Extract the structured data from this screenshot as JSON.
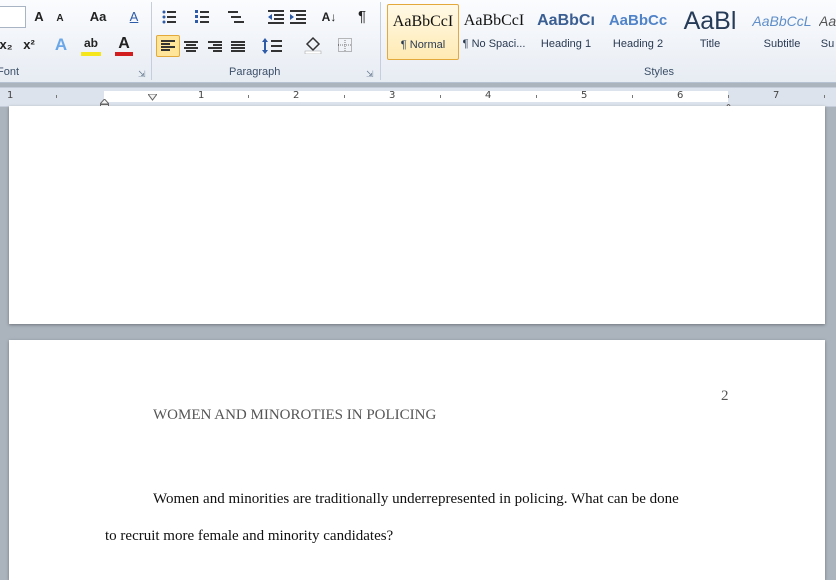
{
  "ribbon": {
    "font_group": {
      "label": "Font",
      "grow": "A",
      "shrink": "A",
      "change_case": "Aa",
      "clear_format": "A",
      "subscript": "x₂",
      "superscript": "x²",
      "text_effects": "A",
      "highlight": "ab",
      "font_color": "A",
      "font_color_value": "#d11d1d",
      "highlight_color_value": "#f5e61c"
    },
    "paragraph_group": {
      "label": "Paragraph",
      "show_marks": "¶",
      "sort": "A↓"
    },
    "styles_group": {
      "label": "Styles",
      "items": [
        {
          "sample": "AaBbCcI",
          "name": "¶ Normal"
        },
        {
          "sample": "AaBbCcI",
          "name": "¶ No Spaci..."
        },
        {
          "sample": "AaBbCı",
          "name": "Heading 1"
        },
        {
          "sample": "AaBbCc",
          "name": "Heading 2"
        },
        {
          "sample": "AaBl",
          "name": "Title"
        },
        {
          "sample": "AaBbCcL",
          "name": "Subtitle"
        },
        {
          "sample": "Aa",
          "name": "Su"
        }
      ]
    }
  },
  "ruler": {
    "numbers": [
      "1",
      "1",
      "2",
      "3",
      "4",
      "5",
      "6",
      "7"
    ]
  },
  "document": {
    "page_number": "2",
    "running_head": "WOMEN AND MINOROTIES IN POLICING",
    "para_line1": "Women and minorities are traditionally underrepresented in policing.  What can be done",
    "para_line2": "to recruit more female and minority candidates?"
  }
}
